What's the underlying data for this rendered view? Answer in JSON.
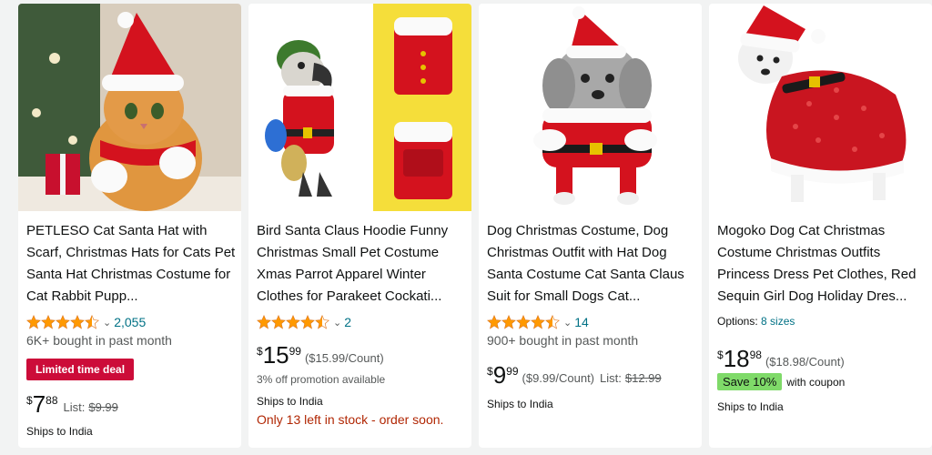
{
  "colors": {
    "accent_link": "#007185",
    "deal_red": "#cc0c39",
    "stock_red": "#b12704",
    "star_orange": "#ff9900",
    "save_green": "#7fda69"
  },
  "products": [
    {
      "title": "PETLESO Cat Santa Hat with Scarf, Christmas Hats for Cats Pet Santa Hat Christmas Costume for Cat Rabbit Pupp...",
      "rating": 4.5,
      "review_count": "2,055",
      "bought": "6K+ bought in past month",
      "deal": "Limited time deal",
      "price_currency": "$",
      "price_whole": "7",
      "price_fraction": "88",
      "list_label": "List:",
      "list_price": "$9.99",
      "ships": "Ships to India",
      "image_icon": "cat-santa-hat-image"
    },
    {
      "title": "Bird Santa Claus Hoodie Funny Christmas Small Pet Costume Xmas Parrot Apparel Winter Clothes for Parakeet Cockati...",
      "rating": 4.5,
      "review_count": "2",
      "price_currency": "$",
      "price_whole": "15",
      "price_fraction": "99",
      "unit_price": "($15.99/Count)",
      "promo": "3% off promotion available",
      "ships": "Ships to India",
      "stock": "Only 13 left in stock - order soon.",
      "image_icon": "parrot-santa-costume-image"
    },
    {
      "title": "Dog Christmas Costume, Dog Christmas Outfit with Hat Dog Santa Costume Cat Santa Claus Suit for Small Dogs Cat...",
      "rating": 4.5,
      "review_count": "14",
      "bought": "900+ bought in past month",
      "price_currency": "$",
      "price_whole": "9",
      "price_fraction": "99",
      "unit_price": "($9.99/Count)",
      "list_label": "List:",
      "list_price": "$12.99",
      "ships": "Ships to India",
      "image_icon": "dog-santa-suit-image"
    },
    {
      "title": "Mogoko Dog Cat Christmas Costume Christmas Outfits Princess Dress Pet Clothes, Red Sequin Girl Dog Holiday Dres...",
      "options_label": "Options:",
      "options_value": "8 sizes",
      "price_currency": "$",
      "price_whole": "18",
      "price_fraction": "98",
      "unit_price": "($18.98/Count)",
      "save_badge": "Save 10%",
      "coupon_text": "with coupon",
      "ships": "Ships to India",
      "image_icon": "dog-sequin-dress-image"
    }
  ]
}
